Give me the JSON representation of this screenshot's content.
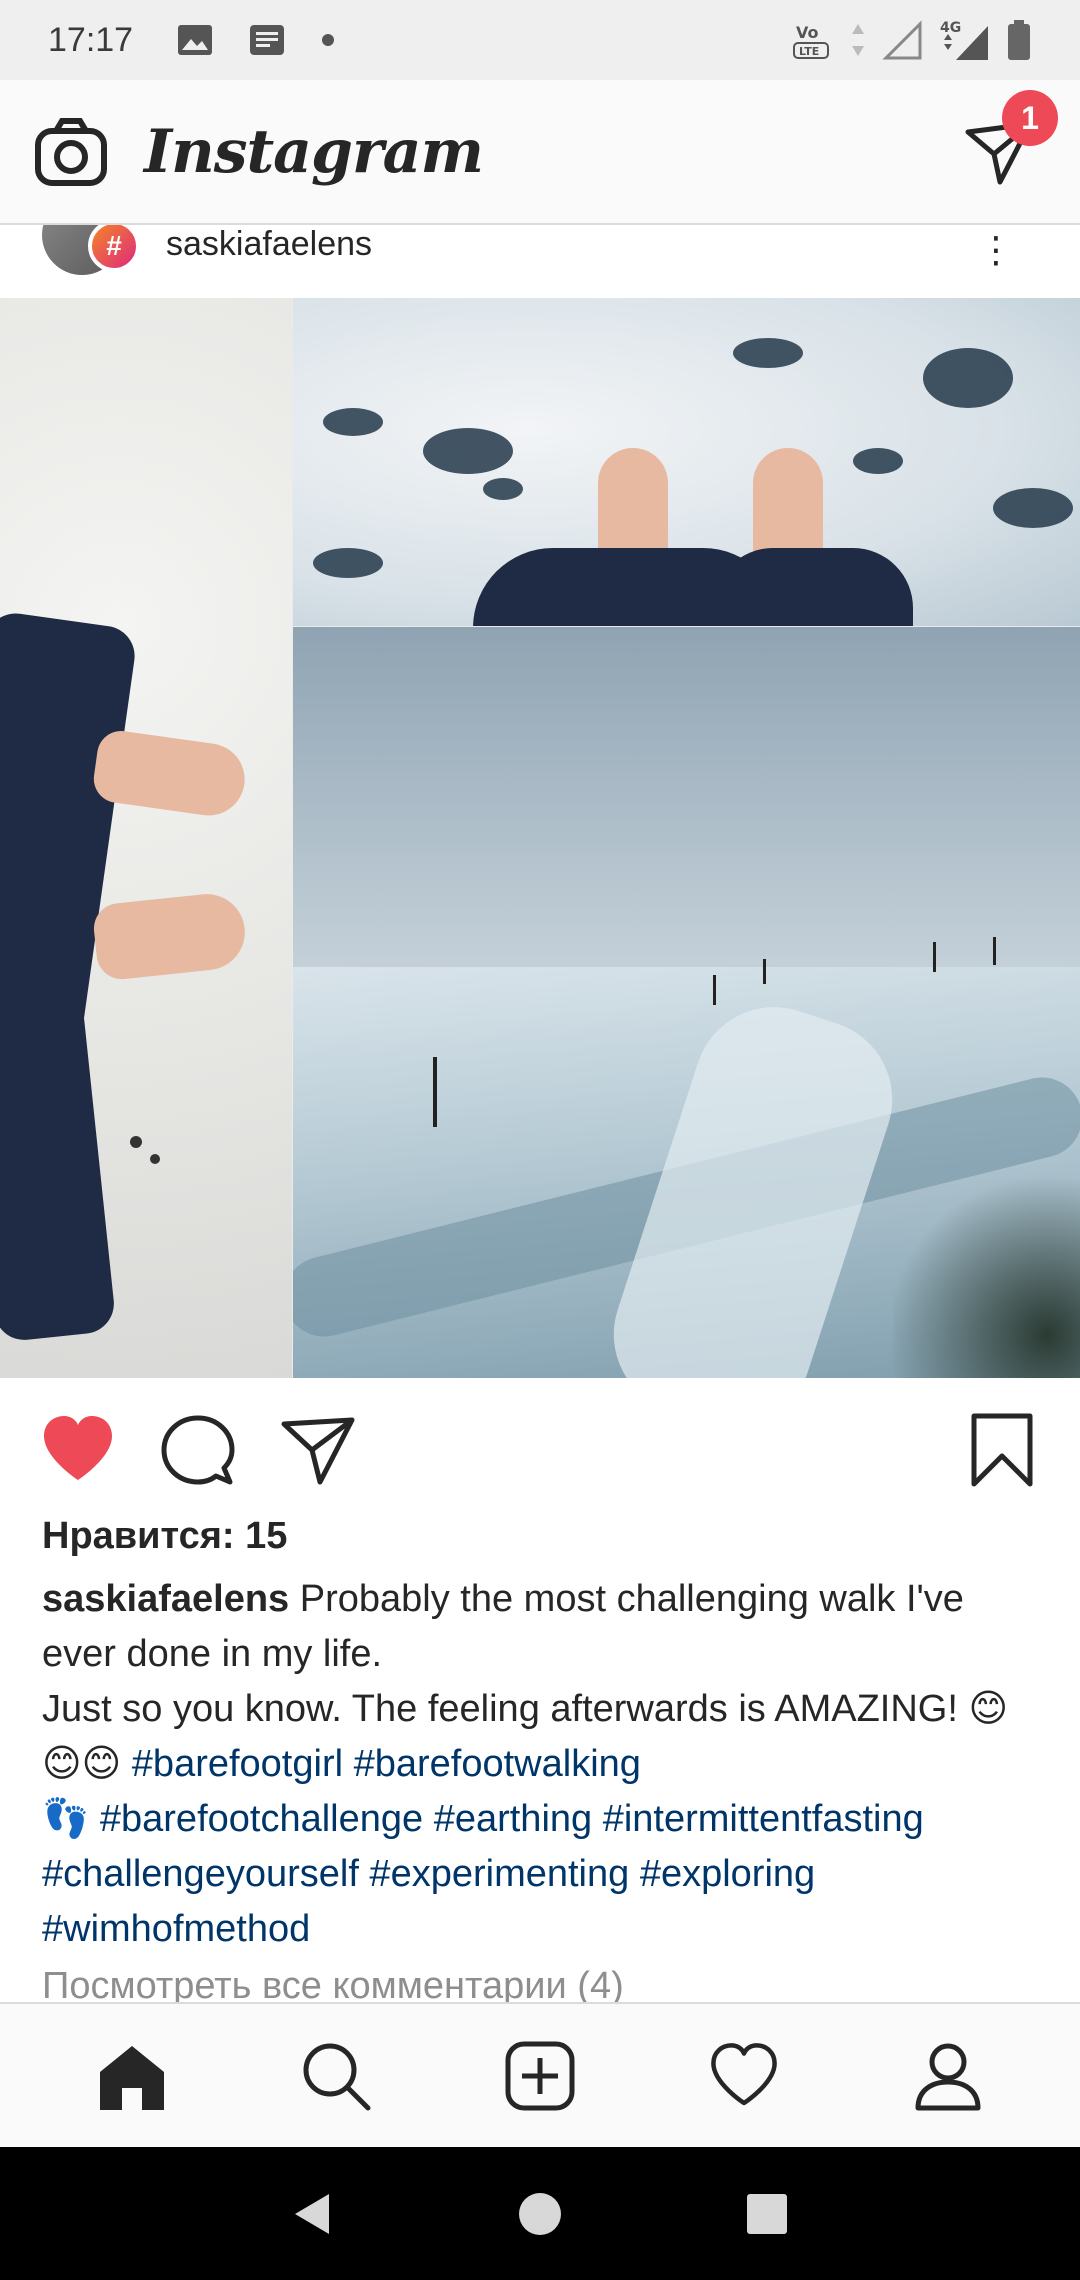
{
  "status_bar": {
    "time": "17:17",
    "left_icons": [
      "image-icon",
      "notes-icon",
      "dot-icon"
    ],
    "right_icons": [
      "volte-icon",
      "signal-arrows-icon",
      "signal-icon",
      "4g-icon",
      "battery-icon"
    ]
  },
  "app_bar": {
    "logo": "Instagram",
    "camera_icon": "camera-icon",
    "direct_icon": "direct-message-icon",
    "direct_badge": "1"
  },
  "post": {
    "username": "saskiafaelens",
    "hash_badge": "#",
    "more": "⋮",
    "likes": "Нравится: 15",
    "caption": {
      "user": "saskiafaelens",
      "line1": " Probably the most challenging walk I've ever done in my life.",
      "line2": "Just so you know. The feeling afterwards is AMAZING! 😊😊😊 ",
      "tags1": "#barefootgirl #barefootwalking",
      "feet": "👣 ",
      "tags2": "#barefootchallenge #earthing #intermittentfasting #challengeyourself #experimenting #exploring #wimhofmethod"
    },
    "view_comments": "Посмотреть все комментарии (4)"
  },
  "colors": {
    "like_red": "#ed4956",
    "hashtag_blue": "#003569",
    "badge_red": "#ed4956"
  },
  "bottom_nav": [
    "home-icon",
    "search-icon",
    "add-post-icon",
    "activity-heart-icon",
    "profile-icon"
  ],
  "system_nav": [
    "back-icon",
    "home-circle-icon",
    "recents-icon"
  ]
}
